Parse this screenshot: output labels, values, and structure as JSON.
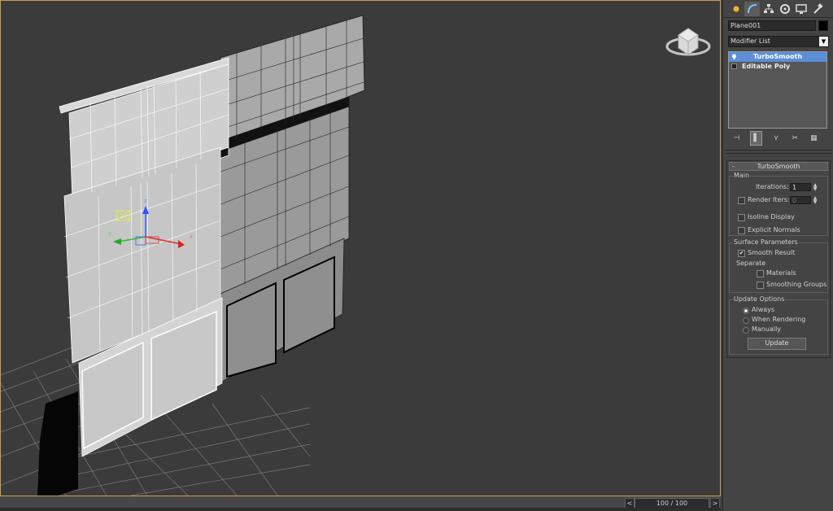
{
  "viewport": {
    "name": "Perspective viewport",
    "axis_x": "x",
    "axis_y": "y",
    "axis_z": "z"
  },
  "timeline": {
    "prev": "<",
    "next": ">",
    "frame": "100 / 100"
  },
  "panel": {
    "tabs": [
      "create-tab",
      "modify-tab",
      "hierarchy-tab",
      "motion-tab",
      "display-tab",
      "utilities-tab"
    ],
    "object_name": "Plane001",
    "object_color": "#000000",
    "modifier_list": "Modifier List",
    "stack": [
      {
        "label": "TurboSmooth",
        "selected": true
      },
      {
        "label": "Editable Poly",
        "selected": false
      }
    ],
    "rollout": {
      "title": "TurboSmooth",
      "main": {
        "title": "Main",
        "iterations_label": "Iterations:",
        "iterations_value": "1",
        "render_iters_label": "Render Iters:",
        "render_iters_value": "0",
        "isoline_display": "Isoline Display",
        "explicit_normals": "Explicit Normals"
      },
      "surface": {
        "title": "Surface Parameters",
        "smooth_result": "Smooth Result",
        "separate": "Separate",
        "materials": "Materials",
        "smoothing_groups": "Smoothing Groups"
      },
      "update": {
        "title": "Update Options",
        "always": "Always",
        "when_rendering": "When Rendering",
        "manually": "Manually",
        "button": "Update"
      }
    }
  }
}
